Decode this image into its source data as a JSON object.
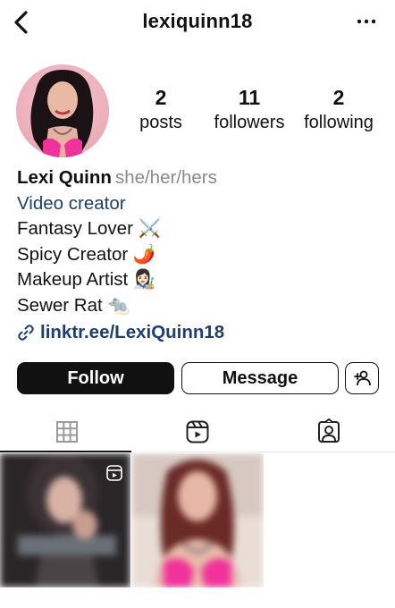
{
  "header": {
    "username": "lexiquinn18"
  },
  "profile": {
    "stats": [
      {
        "value": "2",
        "label": "posts"
      },
      {
        "value": "11",
        "label": "followers"
      },
      {
        "value": "2",
        "label": "following"
      }
    ]
  },
  "bio": {
    "name": "Lexi Quinn",
    "pronouns": "she/her/hers",
    "category": "Video creator",
    "lines": [
      "Fantasy Lover ⚔️",
      "Spicy Creator 🌶️",
      "Makeup Artist 👩🏻‍🎨",
      "Sewer Rat 🐀"
    ],
    "link": "linktr.ee/LexiQuinn18"
  },
  "actions": {
    "follow_label": "Follow",
    "message_label": "Message"
  },
  "icons": {
    "back": "back-arrow-icon",
    "more": "more-options-icon",
    "link": "link-icon",
    "add_user": "add-user-icon",
    "tabs": [
      "grid-icon",
      "reels-icon",
      "tagged-icon"
    ]
  },
  "colors": {
    "follow_button": "#111111",
    "link_text": "#1d3f73",
    "pronouns_text": "#8a8a8a"
  }
}
